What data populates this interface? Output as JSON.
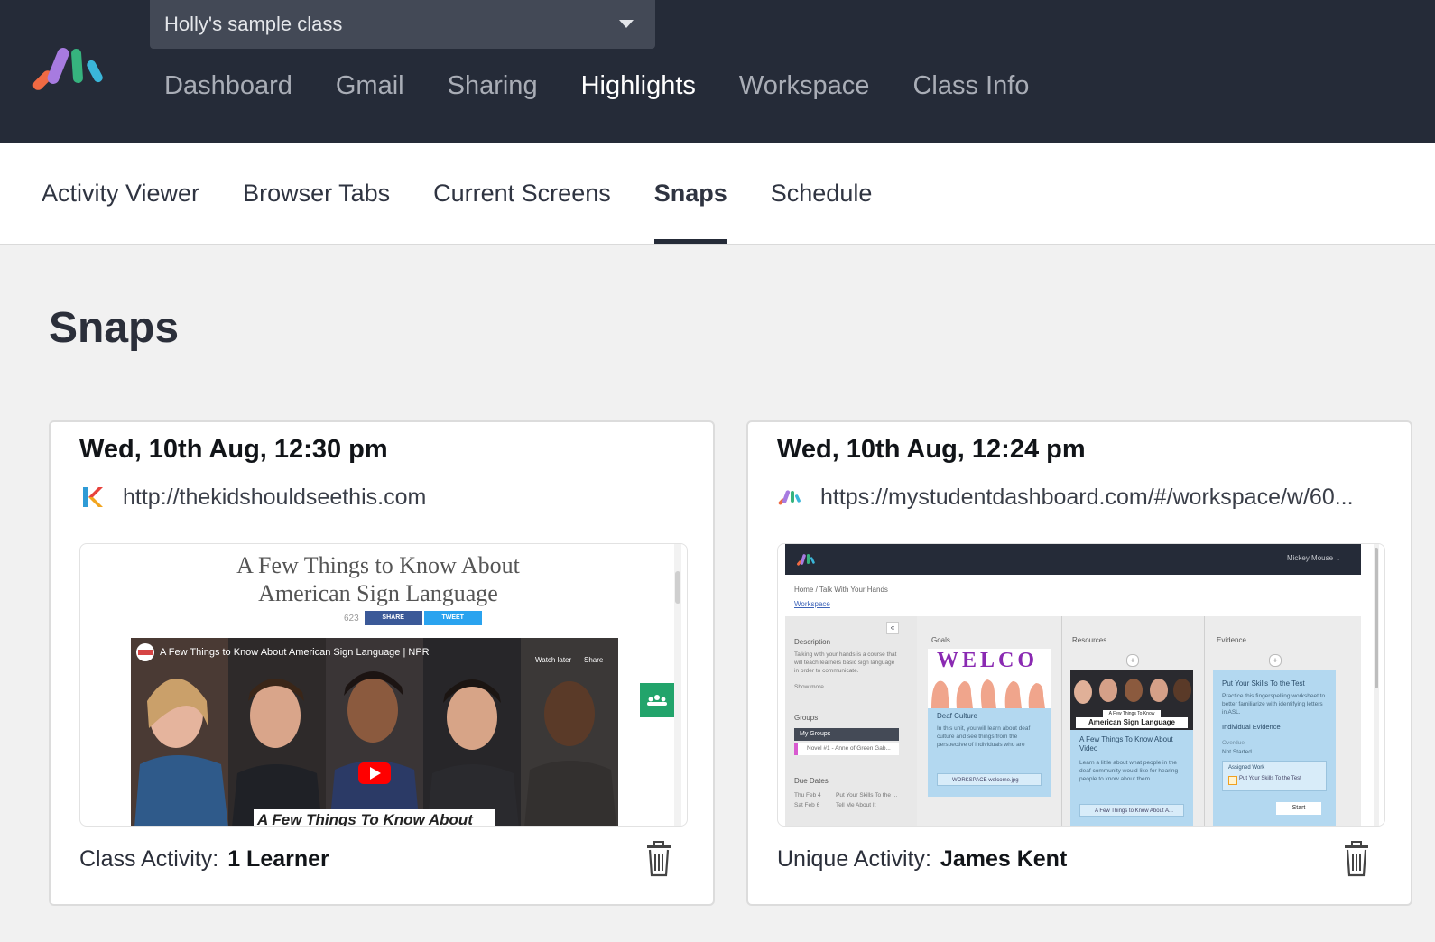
{
  "header": {
    "class_selector": "Holly's sample class",
    "nav": [
      "Dashboard",
      "Gmail",
      "Sharing",
      "Highlights",
      "Workspace",
      "Class Info"
    ],
    "active_nav": "Highlights",
    "logo_colors": [
      "#f06a43",
      "#a77be0",
      "#36b37e",
      "#3ab6d9"
    ]
  },
  "subnav": {
    "items": [
      "Activity Viewer",
      "Browser Tabs",
      "Current Screens",
      "Snaps",
      "Schedule"
    ],
    "active": "Snaps"
  },
  "page": {
    "title": "Snaps"
  },
  "snaps": [
    {
      "time": "Wed, 10th Aug, 12:30 pm",
      "url": "http://thekidshouldseethis.com",
      "favicon": "kidshouldsee-k-icon",
      "footer_label": "Class Activity:",
      "footer_value": "1 Learner",
      "thumbnail": {
        "page_title_line1": "A Few Things to Know About",
        "page_title_line2": "American Sign Language",
        "share_count": "623",
        "share_label": "SHARE",
        "tweet_label": "TWEET",
        "video_title": "A Few Things to Know About American Sign Language | NPR",
        "watch_later": "Watch later",
        "share": "Share",
        "caption": "A Few Things To Know About"
      }
    },
    {
      "time": "Wed, 10th Aug, 12:24 pm",
      "url": "https://mystudentdashboard.com/#/workspace/w/60...",
      "favicon": "mystudentdashboard-logo-icon",
      "footer_label": "Unique Activity:",
      "footer_value": "James Kent",
      "thumbnail": {
        "user": "Mickey Mouse ⌄",
        "crumb": "Home  /  Talk With Your Hands",
        "workspace_link": "Workspace",
        "description_head": "Description",
        "description_text": "Talking with your hands is a course that will teach learners basic sign language in order to communicate.",
        "show_more": "Show more",
        "groups_head": "Groups",
        "my_groups": "My Groups",
        "group_item": "Novel #1 - Anne of Green Gab...",
        "due_head": "Due Dates",
        "due_1_date": "Thu Feb 4",
        "due_1_item": "Put Your Skills To the ...",
        "due_2_date": "Sat Feb 6",
        "due_2_item": "Tell Me About It",
        "goals_head": "Goals",
        "welcome_word": "WELCO",
        "deaf_culture": "Deaf Culture",
        "deaf_culture_text": "In this unit, you will learn about deaf culture and see things from the perspective of individuals who are",
        "attachment": "WORKSPACE welcome.jpg",
        "resources_head": "Resources",
        "asl_banner_small": "A Few Things To Know About",
        "asl_banner": "American Sign Language",
        "resource_title": "A Few Things To Know About Video",
        "resource_text": "Learn a little about what people in the deaf community would like for hearing people to know about them.",
        "resource_link": "A Few Things to Know About A...",
        "evidence_head": "Evidence",
        "evidence_title": "Put Your Skills To the Test",
        "evidence_text": "Practice this fingerspelling worksheet to better familiarize with identifying letters in ASL.",
        "individual_evidence": "Individual Evidence",
        "overdue": "Overdue",
        "not_started": "Not Started",
        "assigned_work": "Assigned Work",
        "assigned_item": "Put Your Skills To the Test",
        "start": "Start"
      }
    }
  ]
}
